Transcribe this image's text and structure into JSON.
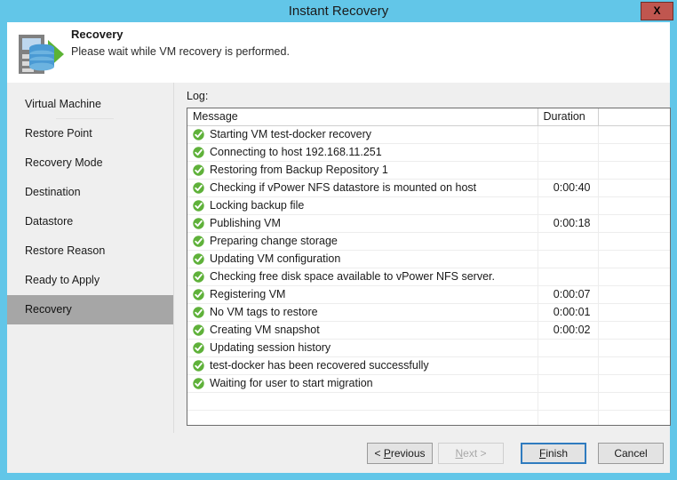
{
  "window": {
    "title": "Instant Recovery",
    "close_label": "X",
    "close_icon": "close-icon"
  },
  "header": {
    "icon": "server-database-play-icon",
    "title": "Recovery",
    "subtitle": "Please wait while VM recovery is performed."
  },
  "sidebar": {
    "items": [
      {
        "label": "Virtual Machine",
        "selected": false
      },
      {
        "label": "Restore Point",
        "selected": false
      },
      {
        "label": "Recovery Mode",
        "selected": false
      },
      {
        "label": "Destination",
        "selected": false
      },
      {
        "label": "Datastore",
        "selected": false
      },
      {
        "label": "Restore Reason",
        "selected": false
      },
      {
        "label": "Ready to Apply",
        "selected": false
      },
      {
        "label": "Recovery",
        "selected": true
      }
    ]
  },
  "content": {
    "log_label": "Log:",
    "columns": [
      "Message",
      "Duration",
      ""
    ],
    "rows": [
      {
        "icon": "success-check-icon",
        "message": "Starting VM test-docker recovery",
        "duration": ""
      },
      {
        "icon": "success-check-icon",
        "message": "Connecting to host 192.168.11.251",
        "duration": ""
      },
      {
        "icon": "success-check-icon",
        "message": "Restoring from Backup Repository 1",
        "duration": ""
      },
      {
        "icon": "success-check-icon",
        "message": "Checking if vPower NFS datastore is mounted on host",
        "duration": "0:00:40"
      },
      {
        "icon": "success-check-icon",
        "message": "Locking backup file",
        "duration": ""
      },
      {
        "icon": "success-check-icon",
        "message": "Publishing VM",
        "duration": "0:00:18"
      },
      {
        "icon": "success-check-icon",
        "message": "Preparing change storage",
        "duration": ""
      },
      {
        "icon": "success-check-icon",
        "message": "Updating VM configuration",
        "duration": ""
      },
      {
        "icon": "success-check-icon",
        "message": "Checking free disk space available to vPower NFS server.",
        "duration": ""
      },
      {
        "icon": "success-check-icon",
        "message": "Registering VM",
        "duration": "0:00:07"
      },
      {
        "icon": "success-check-icon",
        "message": "No VM tags to restore",
        "duration": "0:00:01"
      },
      {
        "icon": "success-check-icon",
        "message": "Creating VM snapshot",
        "duration": "0:00:02"
      },
      {
        "icon": "success-check-icon",
        "message": "Updating session history",
        "duration": ""
      },
      {
        "icon": "success-check-icon",
        "message": "test-docker has been recovered successfully",
        "duration": ""
      },
      {
        "icon": "success-check-icon",
        "message": "Waiting for user to start migration",
        "duration": ""
      }
    ]
  },
  "footer": {
    "previous": {
      "prefix": "< ",
      "underlined": "P",
      "rest": "revious",
      "disabled": false
    },
    "next": {
      "prefix": "",
      "underlined": "N",
      "rest": "ext >",
      "disabled": true
    },
    "finish": {
      "prefix": "",
      "underlined": "F",
      "rest": "inish",
      "disabled": false,
      "default": true
    },
    "cancel": {
      "prefix": "",
      "underlined": "",
      "rest": "Cancel",
      "disabled": false
    }
  },
  "colors": {
    "window_frame": "#62c6e8",
    "close_button": "#c0564f",
    "selected_nav": "#a6a6a6",
    "success_green": "#5fb13a",
    "default_button_border": "#2f7bbf"
  }
}
